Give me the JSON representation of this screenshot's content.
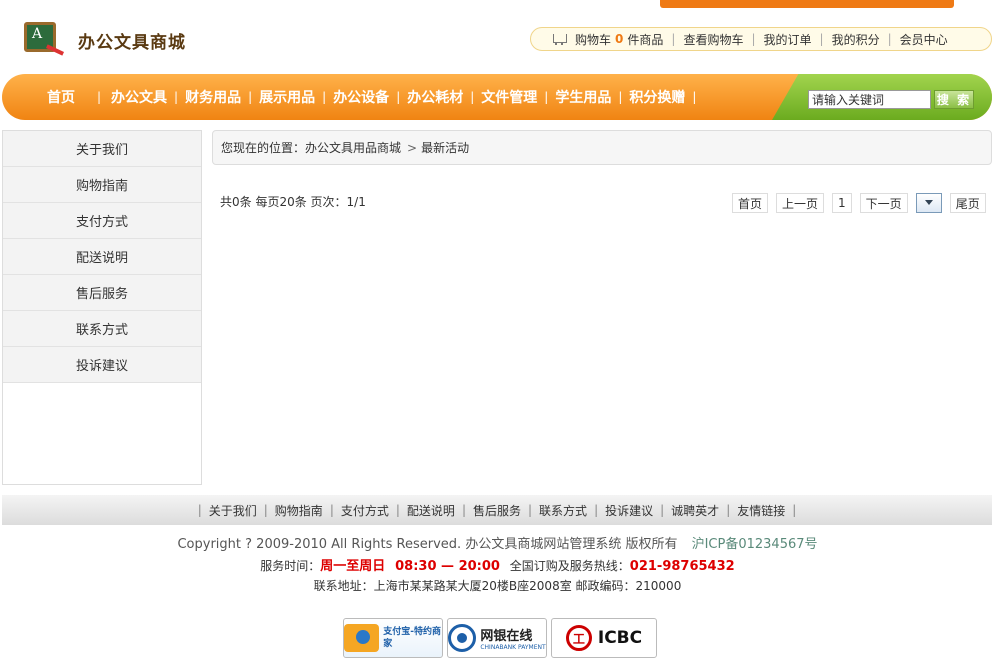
{
  "header": {
    "logo_text": "办公文具商城",
    "cart_label": "购物车",
    "cart_count": "0",
    "cart_unit": "件商品",
    "links": [
      "查看购物车",
      "我的订单",
      "我的积分",
      "会员中心"
    ]
  },
  "nav": {
    "items": [
      "首页",
      "办公文具",
      "财务用品",
      "展示用品",
      "办公设备",
      "办公耗材",
      "文件管理",
      "学生用品",
      "积分换赠"
    ],
    "search_value": "请输入关键词",
    "search_button": "搜 索"
  },
  "sidebar": {
    "items": [
      "关于我们",
      "购物指南",
      "支付方式",
      "配送说明",
      "售后服务",
      "联系方式",
      "投诉建议"
    ]
  },
  "breadcrumb": {
    "prefix": "您现在的位置：",
    "home": "办公文具用品商城",
    "current": "最新活动"
  },
  "pagination": {
    "summary": "共0条  每页20条  页次：1/1",
    "first": "首页",
    "prev": "上一页",
    "current": "1",
    "next": "下一页",
    "last": "尾页"
  },
  "footer": {
    "links": [
      "关于我们",
      "购物指南",
      "支付方式",
      "配送说明",
      "售后服务",
      "联系方式",
      "投诉建议",
      "诚聘英才",
      "友情链接"
    ],
    "copyright": "Copyright ? 2009-2010 All Rights Reserved. 办公文具商城网站管理系统 版权所有",
    "icp": "沪ICP备01234567号",
    "service_label": "服务时间：",
    "service_days": "周一至周日",
    "service_hours": "08:30 — 20:00",
    "hotline_label": "全国订购及服务热线：",
    "hotline": "021-98765432",
    "address": "联系地址：上海市某某路某大厦20楼B座2008室    邮政编码：210000",
    "badges": {
      "alipay": "支付宝-特约商家",
      "chinabank": "网银在线",
      "chinabank_sub": "CHINABANK PAYMENT",
      "icbc": "ICBC",
      "icbc_symbol": "工"
    }
  },
  "colors": {
    "nav_orange": "#f08412",
    "accent_green": "#6bab1f",
    "price_red": "#dd0000"
  }
}
